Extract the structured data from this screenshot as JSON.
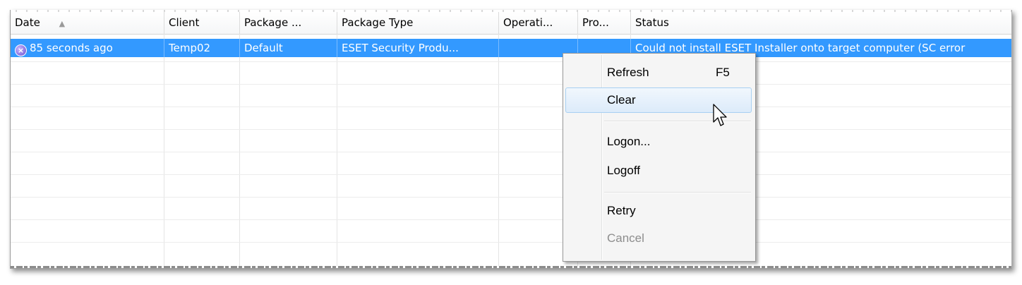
{
  "columns": [
    {
      "label": "Date",
      "sort": "▲"
    },
    {
      "label": "Client"
    },
    {
      "label": "Package ..."
    },
    {
      "label": "Package Type"
    },
    {
      "label": "Operati..."
    },
    {
      "label": "Pro..."
    },
    {
      "label": "Status"
    }
  ],
  "rows": [
    {
      "date": "85 seconds ago",
      "client": "Temp02",
      "package": "Default",
      "package_type": "ESET Security Produ...",
      "operation": "",
      "progress": "",
      "status": "Could not install ESET Installer onto target computer (SC error"
    }
  ],
  "context_menu": {
    "refresh": {
      "label": "Refresh",
      "shortcut": "F5"
    },
    "clear": {
      "label": "Clear"
    },
    "logon": {
      "label": "Logon..."
    },
    "logoff": {
      "label": "Logoff"
    },
    "retry": {
      "label": "Retry"
    },
    "cancel": {
      "label": "Cancel"
    }
  },
  "colors": {
    "selection": "#3399ff",
    "error_icon": "#6a4fd0",
    "menu_hover_border": "#a8d0f2"
  },
  "icons": {
    "status": "error-circle-icon",
    "pointer": "mouse-pointer-icon"
  }
}
